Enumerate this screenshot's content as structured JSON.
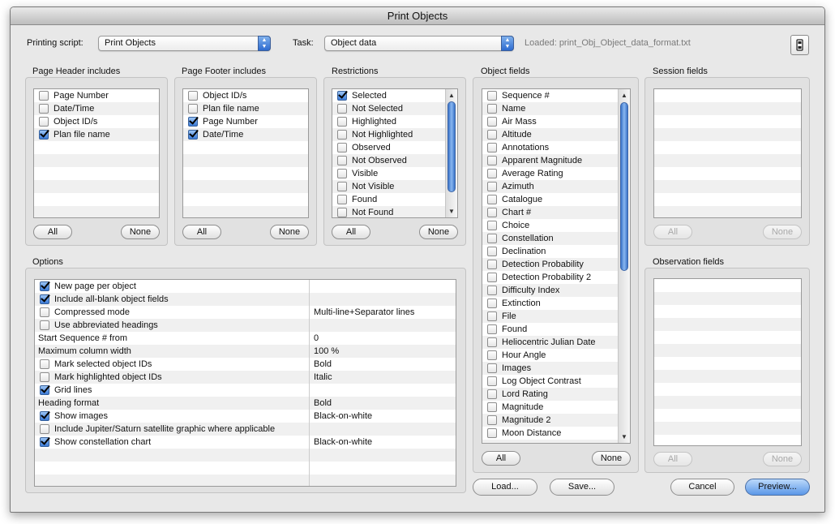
{
  "window": {
    "title": "Print Objects"
  },
  "toolbar": {
    "printing_script_label": "Printing script:",
    "printing_script_value": "Print Objects",
    "task_label": "Task:",
    "task_value": "Object data",
    "loaded_text": "Loaded: print_Obj_Object_data_format.txt"
  },
  "page_header": {
    "title": "Page Header includes",
    "items": [
      {
        "label": "Page Number",
        "checked": false
      },
      {
        "label": "Date/Time",
        "checked": false
      },
      {
        "label": "Object ID/s",
        "checked": false
      },
      {
        "label": "Plan file name",
        "checked": true
      }
    ],
    "all_label": "All",
    "none_label": "None"
  },
  "page_footer": {
    "title": "Page Footer includes",
    "items": [
      {
        "label": "Object ID/s",
        "checked": false
      },
      {
        "label": "Plan file name",
        "checked": false
      },
      {
        "label": "Page Number",
        "checked": true
      },
      {
        "label": "Date/Time",
        "checked": true
      }
    ],
    "all_label": "All",
    "none_label": "None"
  },
  "restrictions": {
    "title": "Restrictions",
    "items": [
      {
        "label": "Selected",
        "checked": true
      },
      {
        "label": "Not Selected",
        "checked": false
      },
      {
        "label": "Highlighted",
        "checked": false
      },
      {
        "label": "Not Highlighted",
        "checked": false
      },
      {
        "label": "Observed",
        "checked": false
      },
      {
        "label": "Not Observed",
        "checked": false
      },
      {
        "label": "Visible",
        "checked": false
      },
      {
        "label": "Not Visible",
        "checked": false
      },
      {
        "label": "Found",
        "checked": false
      },
      {
        "label": "Not Found",
        "checked": false
      }
    ],
    "all_label": "All",
    "none_label": "None"
  },
  "object_fields": {
    "title": "Object fields",
    "items": [
      {
        "label": "Sequence #",
        "checked": false
      },
      {
        "label": "Name",
        "checked": false
      },
      {
        "label": "Air Mass",
        "checked": false
      },
      {
        "label": "Altitude",
        "checked": false
      },
      {
        "label": "Annotations",
        "checked": false
      },
      {
        "label": "Apparent Magnitude",
        "checked": false
      },
      {
        "label": "Average Rating",
        "checked": false
      },
      {
        "label": "Azimuth",
        "checked": false
      },
      {
        "label": "Catalogue",
        "checked": false
      },
      {
        "label": "Chart #",
        "checked": false
      },
      {
        "label": "Choice",
        "checked": false
      },
      {
        "label": "Constellation",
        "checked": false
      },
      {
        "label": "Declination",
        "checked": false
      },
      {
        "label": "Detection Probability",
        "checked": false
      },
      {
        "label": "Detection Probability 2",
        "checked": false
      },
      {
        "label": "Difficulty Index",
        "checked": false
      },
      {
        "label": "Extinction",
        "checked": false
      },
      {
        "label": "File",
        "checked": false
      },
      {
        "label": "Found",
        "checked": false
      },
      {
        "label": "Heliocentric Julian Date",
        "checked": false
      },
      {
        "label": "Hour Angle",
        "checked": false
      },
      {
        "label": "Images",
        "checked": false
      },
      {
        "label": "Log Object Contrast",
        "checked": false
      },
      {
        "label": "Lord Rating",
        "checked": false
      },
      {
        "label": "Magnitude",
        "checked": false
      },
      {
        "label": "Magnitude 2",
        "checked": false
      },
      {
        "label": "Moon Distance",
        "checked": false
      }
    ],
    "all_label": "All",
    "none_label": "None"
  },
  "session_fields": {
    "title": "Session fields",
    "all_label": "All",
    "none_label": "None"
  },
  "observation_fields": {
    "title": "Observation fields",
    "all_label": "All",
    "none_label": "None"
  },
  "options": {
    "title": "Options",
    "rows": [
      {
        "label": "New page per object",
        "checkbox": true,
        "checked": true,
        "value": ""
      },
      {
        "label": "Include all-blank object fields",
        "checkbox": true,
        "checked": true,
        "value": ""
      },
      {
        "label": "Compressed mode",
        "checkbox": true,
        "checked": false,
        "value": "Multi-line+Separator lines"
      },
      {
        "label": "Use abbreviated headings",
        "checkbox": true,
        "checked": false,
        "value": ""
      },
      {
        "label": "Start Sequence # from",
        "checkbox": false,
        "checked": false,
        "value": "0"
      },
      {
        "label": "Maximum column width",
        "checkbox": false,
        "checked": false,
        "value": "100 %"
      },
      {
        "label": "Mark selected object IDs",
        "checkbox": true,
        "checked": false,
        "value": "Bold"
      },
      {
        "label": "Mark highlighted object IDs",
        "checkbox": true,
        "checked": false,
        "value": "Italic"
      },
      {
        "label": "Grid lines",
        "checkbox": true,
        "checked": true,
        "value": ""
      },
      {
        "label": "Heading format",
        "checkbox": false,
        "checked": false,
        "value": "Bold"
      },
      {
        "label": "Show images",
        "checkbox": true,
        "checked": true,
        "value": "Black-on-white"
      },
      {
        "label": "Include Jupiter/Saturn satellite graphic where applicable",
        "checkbox": true,
        "checked": false,
        "value": ""
      },
      {
        "label": "Show constellation chart",
        "checkbox": true,
        "checked": true,
        "value": "Black-on-white"
      }
    ]
  },
  "bottom": {
    "load_label": "Load...",
    "save_label": "Save...",
    "cancel_label": "Cancel",
    "preview_label": "Preview..."
  }
}
